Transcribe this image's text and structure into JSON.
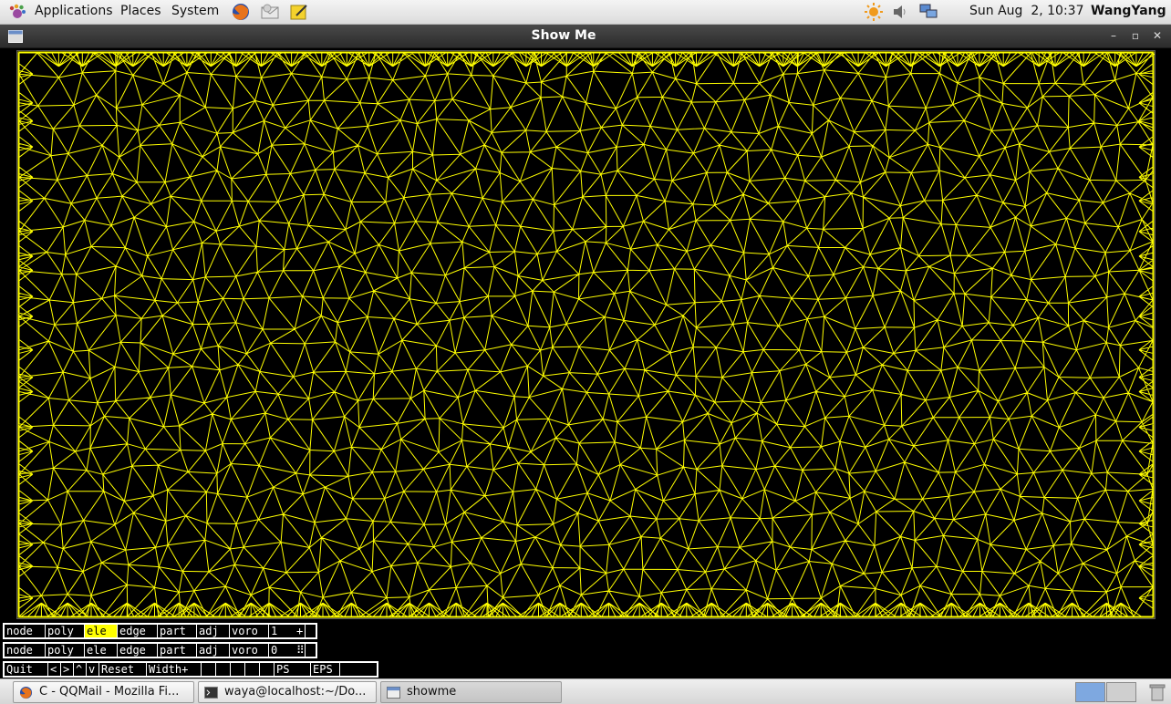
{
  "top_panel": {
    "menus": [
      "Applications",
      "Places",
      "System"
    ],
    "clock": "Sun Aug  2, 10:37",
    "user": "WangYang"
  },
  "window": {
    "title": "Show Me"
  },
  "controls": {
    "row1": [
      "node",
      "poly",
      "ele",
      "edge",
      "part",
      "adj",
      "voro",
      "1",
      "+"
    ],
    "row2": [
      "node",
      "poly",
      "ele",
      "edge",
      "part",
      "adj",
      "voro",
      "0",
      "⠿"
    ],
    "row3": [
      "Quit",
      "<",
      ">",
      "^",
      "v",
      "Reset",
      "Width+",
      "",
      "",
      "",
      "",
      "",
      "PS",
      "EPS"
    ],
    "active_button": "ele"
  },
  "taskbar": {
    "tasks": [
      {
        "label": "C - QQMail - Mozilla Fi...",
        "icon": "firefox-icon"
      },
      {
        "label": "waya@localhost:~/Do...",
        "icon": "terminal-icon"
      },
      {
        "label": "showme",
        "icon": "window-icon"
      }
    ]
  },
  "colors": {
    "mesh": "#ffff00",
    "background": "#000000",
    "active_button": "#ffff00"
  }
}
